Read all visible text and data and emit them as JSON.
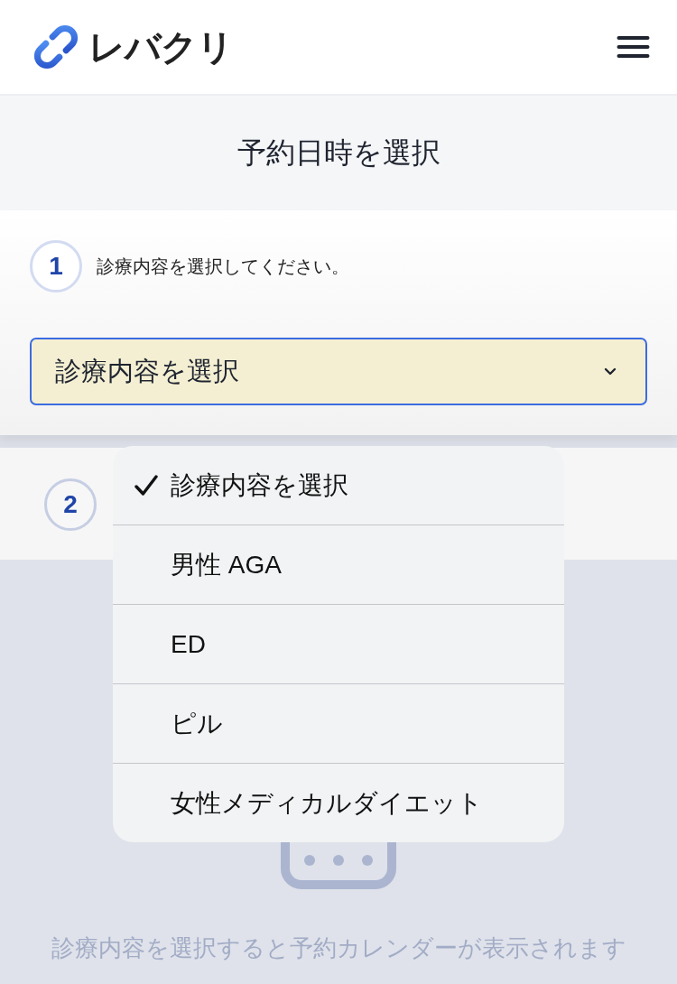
{
  "header": {
    "logo_text": "レバクリ"
  },
  "page_title": "予約日時を選択",
  "steps": [
    {
      "number": "1",
      "instruction": "診療内容を選択してください。",
      "select": {
        "value": "診療内容を選択",
        "focused": true
      }
    },
    {
      "number": "2"
    }
  ],
  "calendar_placeholder": {
    "message": "診療内容を選択すると予約カレンダーが表示されます"
  },
  "dropdown": {
    "options": [
      {
        "label": "診療内容を選択",
        "selected": true
      },
      {
        "label": "男性 AGA",
        "selected": false
      },
      {
        "label": "ED",
        "selected": false
      },
      {
        "label": "ピル",
        "selected": false
      },
      {
        "label": "女性メディカルダイエット",
        "selected": false
      }
    ]
  }
}
